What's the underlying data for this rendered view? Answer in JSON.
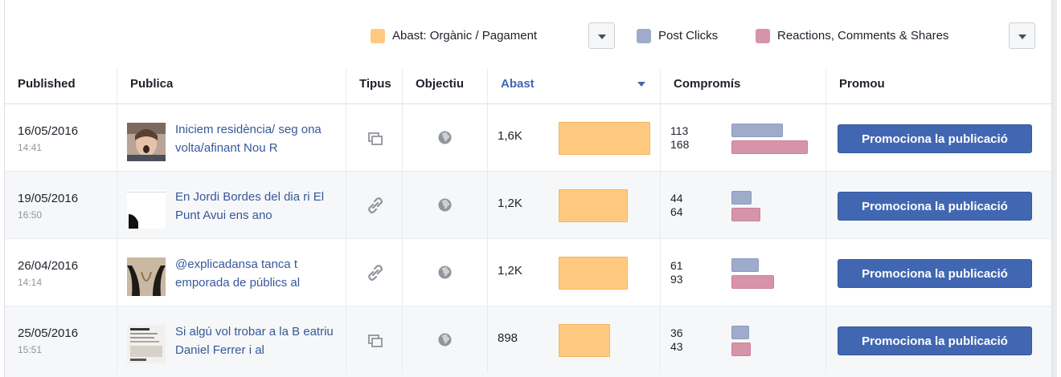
{
  "legend": {
    "reach_label": "Abast: Orgànic / Pagament",
    "clicks_label": "Post Clicks",
    "reactions_label": "Reactions, Comments & Shares",
    "reach_color": "#ffc980",
    "clicks_color": "#9fabcb",
    "reactions_color": "#d794a8"
  },
  "columns": {
    "published": "Published",
    "publica": "Publica",
    "tipus": "Tipus",
    "objectiu": "Objectiu",
    "abast": "Abast",
    "compromis": "Compromís",
    "promou": "Promou"
  },
  "rows": [
    {
      "date": "16/05/2016",
      "time": "14:41",
      "text": "Iniciem residència/ seg ona volta/afinant Nou R",
      "type_icon": "album-icon",
      "objective_icon": "globe-icon",
      "reach": "1,6K",
      "reach_value": 1600,
      "post_clicks": "113",
      "reactions": "168",
      "promote": "Promociona la publicació"
    },
    {
      "date": "19/05/2016",
      "time": "16:50",
      "text": "En Jordi Bordes del dia ri El Punt Avui ens ano",
      "type_icon": "link-icon",
      "objective_icon": "globe-icon",
      "reach": "1,2K",
      "reach_value": 1200,
      "post_clicks": "44",
      "reactions": "64",
      "promote": "Promociona la publicació"
    },
    {
      "date": "26/04/2016",
      "time": "14:14",
      "text": "@explicadansa tanca t emporada de públics al",
      "type_icon": "link-icon",
      "objective_icon": "globe-icon",
      "reach": "1,2K",
      "reach_value": 1200,
      "post_clicks": "61",
      "reactions": "93",
      "promote": "Promociona la publicació"
    },
    {
      "date": "25/05/2016",
      "time": "15:51",
      "text": "Si algú vol trobar a la B eatriu Daniel Ferrer i al",
      "type_icon": "album-icon",
      "objective_icon": "globe-icon",
      "reach": "898",
      "reach_value": 898,
      "post_clicks": "36",
      "reactions": "43",
      "promote": "Promociona la publicació"
    }
  ]
}
